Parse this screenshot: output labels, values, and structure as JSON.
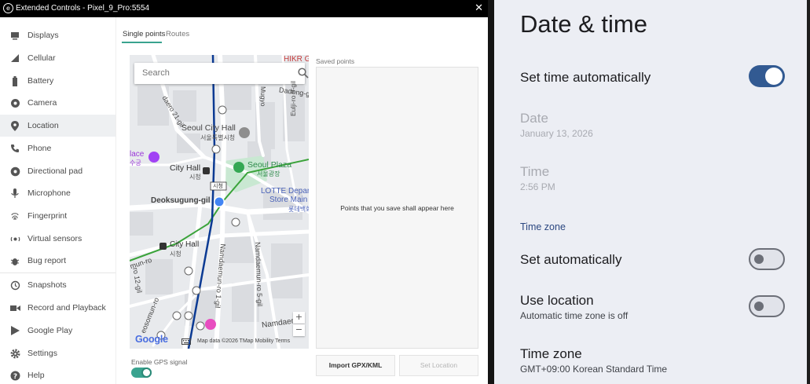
{
  "window": {
    "title": "Extended Controls - Pixel_9_Pro:5554",
    "close_label": "✕"
  },
  "sidebar": {
    "items": [
      {
        "label": "Displays",
        "icon": "monitor-icon"
      },
      {
        "label": "Cellular",
        "icon": "signal-icon"
      },
      {
        "label": "Battery",
        "icon": "battery-icon"
      },
      {
        "label": "Camera",
        "icon": "camera-icon"
      },
      {
        "label": "Location",
        "icon": "location-pin-icon",
        "selected": true
      },
      {
        "label": "Phone",
        "icon": "phone-icon"
      },
      {
        "label": "Directional pad",
        "icon": "dpad-icon"
      },
      {
        "label": "Microphone",
        "icon": "microphone-icon"
      },
      {
        "label": "Fingerprint",
        "icon": "fingerprint-icon"
      },
      {
        "label": "Virtual sensors",
        "icon": "sensors-icon"
      },
      {
        "label": "Bug report",
        "icon": "bug-icon"
      },
      {
        "label": "Snapshots",
        "icon": "history-icon"
      },
      {
        "label": "Record and Playback",
        "icon": "video-camera-icon"
      },
      {
        "label": "Google Play",
        "icon": "play-store-icon"
      },
      {
        "label": "Settings",
        "icon": "gear-icon"
      },
      {
        "label": "Help",
        "icon": "help-icon"
      }
    ]
  },
  "location": {
    "tabs": [
      "Single points",
      "Routes"
    ],
    "search_placeholder": "Search",
    "saved_points_title": "Saved points",
    "saved_points_empty": "Points that you save shall appear here",
    "gps_label": "Enable GPS signal",
    "import_button": "Import GPX/KML",
    "set_location_button": "Set Location",
    "map": {
      "labels": {
        "hikr": "HIKR G",
        "dadong": "Dadong-g",
        "seoul_city_hall": "Seoul City Hall",
        "seoul_city_hall_ko": "서울특별시청",
        "city_hall": "City Hall",
        "city_hall_ko": "시청",
        "seoul_plaza": "Seoul Plaza",
        "seoul_plaza_ko": "서울광장",
        "lotte": "LOTTE Depar",
        "store_main": "Store Main",
        "lotte_ko": "롯데백화",
        "deoksugung": "Deoksugung-gil",
        "station_sign": "시청",
        "place": "lace",
        "place_ko": "수궁",
        "city_hall_2": "City Hall",
        "city_hall_2_ko": "시청",
        "namdaemun": "Namdaem",
        "namdaemun_ro_1": "Namdaemun-ro 1-gil",
        "namdaemun_ro_5": "Namdaemun-ro 5-gil",
        "ro21": "daero 21-gil",
        "sejong": "Mugyo",
        "euljiro": "Eulji-ro 9-gil",
        "jun_ro": "mun-ro",
        "ro12": "ro 12-gil",
        "seosomun": "eosomun-ro"
      },
      "google_logo": "Google",
      "map_data": "Map data ©2026 TMap Mobility    Terms",
      "zoom_in": "+",
      "zoom_out": "−"
    }
  },
  "android": {
    "title": "Date & time",
    "set_time_auto": "Set time automatically",
    "set_time_auto_on": true,
    "date_label": "Date",
    "date_value": "January 13, 2026",
    "time_label": "Time",
    "time_value": "2:56 PM",
    "timezone_header": "Time zone",
    "tz_set_auto": "Set automatically",
    "tz_set_auto_on": false,
    "use_location": "Use location",
    "use_location_summary": "Automatic time zone is off",
    "use_location_on": false,
    "timezone_label": "Time zone",
    "timezone_value": "GMT+09:00 Korean Standard Time"
  },
  "colors": {
    "accent_teal": "#3aa38f",
    "android_switch_on": "#325a92",
    "android_bg": "#eceef4",
    "map_subway_blue": "#0b3a93",
    "map_subway_green": "#3aa33a",
    "location_dot": "#4285f4"
  }
}
